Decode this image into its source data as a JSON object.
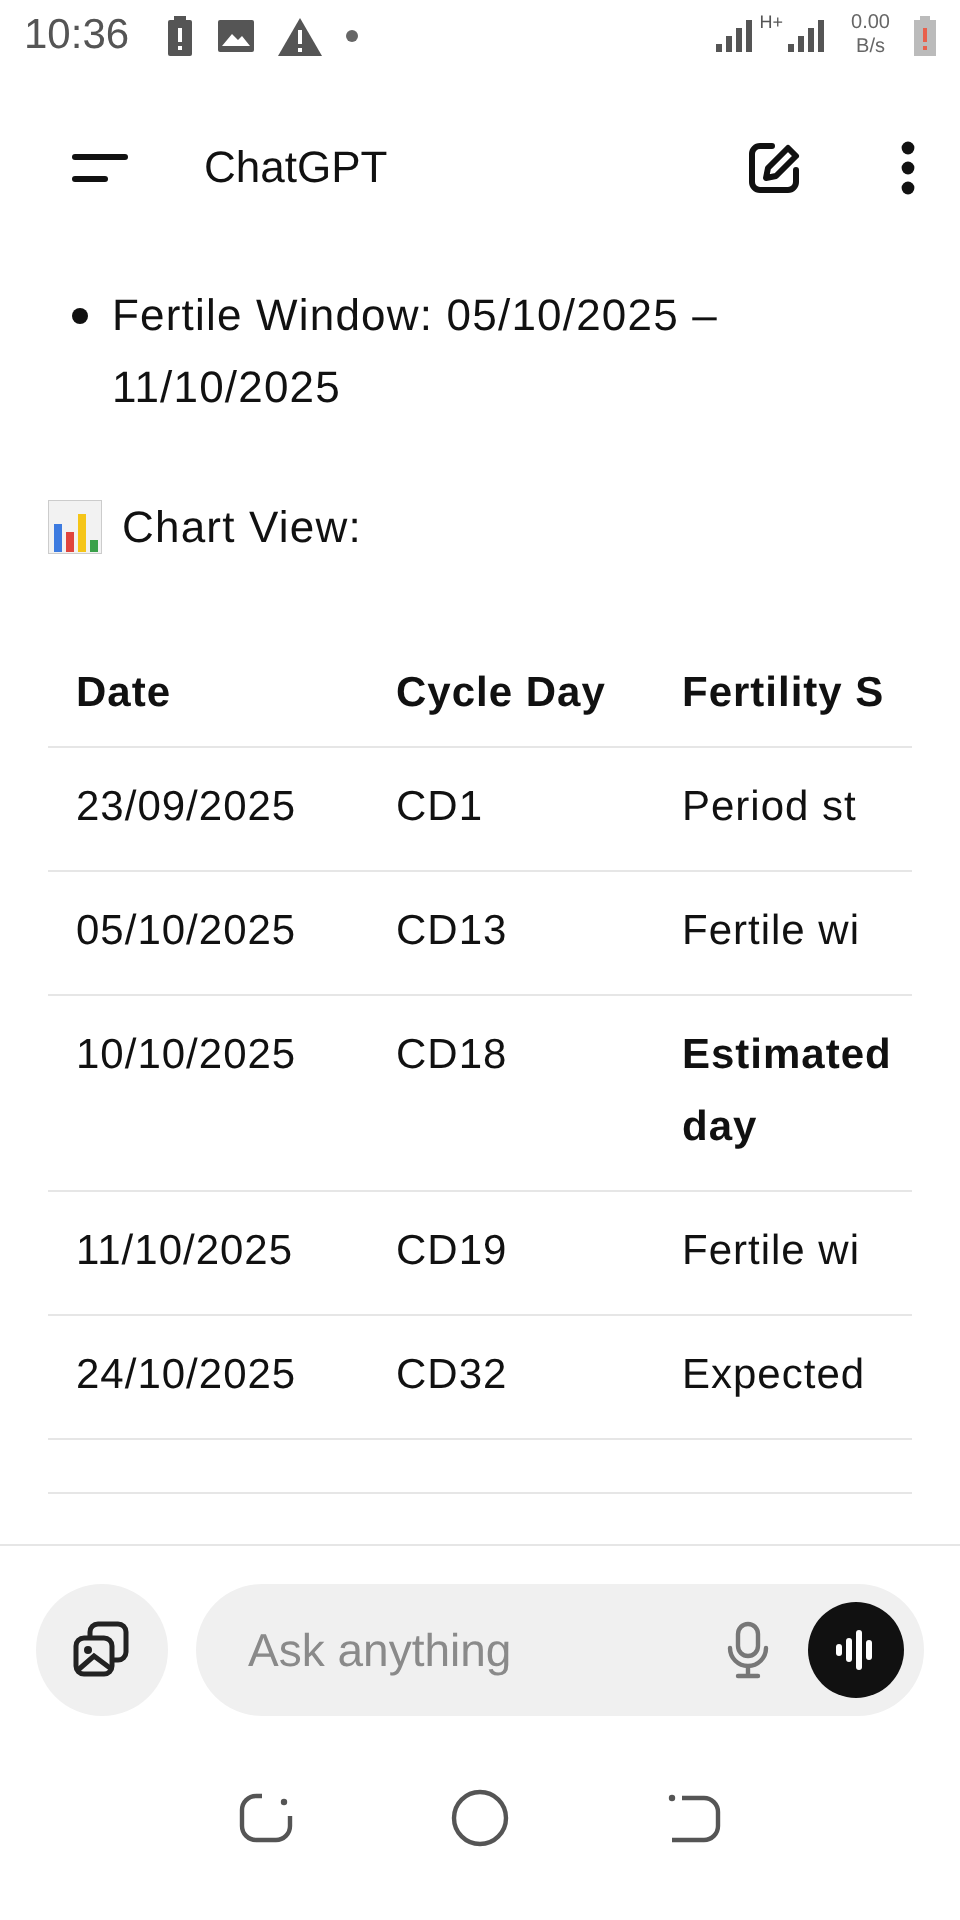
{
  "status_bar": {
    "time": "10:36",
    "network_type": "H+",
    "speed_value": "0.00",
    "speed_unit": "B/s"
  },
  "header": {
    "title": "ChatGPT"
  },
  "message": {
    "bullets": [
      "Fertile Window: 05/10/2025 – 11/10/2025"
    ],
    "chart_heading": "Chart View:"
  },
  "table": {
    "columns": [
      "Date",
      "Cycle Day",
      "Fertility S"
    ],
    "rows": [
      {
        "cells": [
          "23/09/2025",
          "CD1",
          "Period st"
        ],
        "bold_last": false
      },
      {
        "cells": [
          "05/10/2025",
          "CD13",
          "Fertile wi"
        ],
        "bold_last": false
      },
      {
        "cells": [
          "10/10/2025",
          "CD18",
          "Estimated day"
        ],
        "bold_last": true
      },
      {
        "cells": [
          "11/10/2025",
          "CD19",
          "Fertile wi"
        ],
        "bold_last": false
      },
      {
        "cells": [
          "24/10/2025",
          "CD32",
          "Expected"
        ],
        "bold_last": false
      }
    ]
  },
  "composer": {
    "placeholder": "Ask anything"
  }
}
